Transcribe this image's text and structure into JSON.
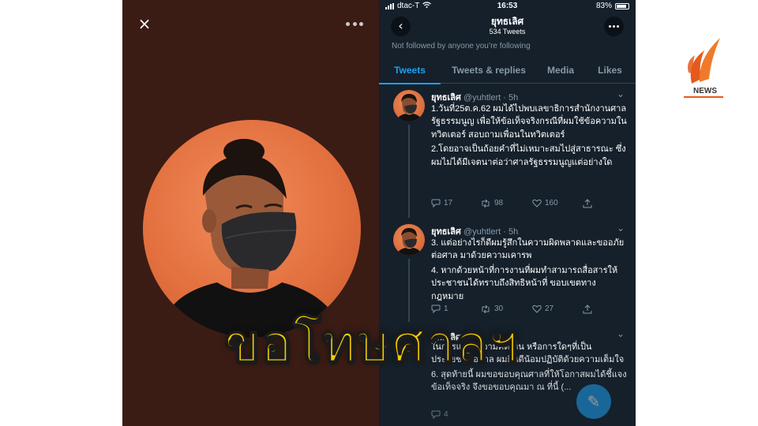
{
  "photo_viewer": {
    "close_icon_glyph": "×",
    "more_icon": "more-horizontal-icon"
  },
  "status_bar": {
    "carrier": "dtac-T",
    "time": "16:53",
    "battery": "83%"
  },
  "profile": {
    "name": "ยุทธเลิศ",
    "tweet_count": "534 Tweets",
    "follow_note": "Not followed by anyone you’re following"
  },
  "tabs": [
    {
      "label": "Tweets",
      "active": true
    },
    {
      "label": "Tweets & replies",
      "active": false
    },
    {
      "label": "Media",
      "active": false
    },
    {
      "label": "Likes",
      "active": false
    }
  ],
  "tweets": [
    {
      "name": "ยุทธเลิศ",
      "handle": "@yuhtlert · 5h",
      "paragraphs": [
        "1.วันที่25ต.ค.62 ผมได้ไปพบเลขาธิการสำนักงานศาลรัฐธรรมนูญ เพื่อให้ข้อเท็จจริงกรณีที่ผมใช้ข้อความในทวิตเตอร์ สอบถามเพื่อนในทวิตเตอร์",
        "2.โดยอาจเป็นถ้อยคำที่ไม่เหมาะสมไปสู่สาธารณะ ซึ่งผมไม่ได้มีเจตนาต่อว่าศาลรัฐธรรมนูญแต่อย่างใด"
      ],
      "replies": "17",
      "retweets": "98",
      "likes": "160"
    },
    {
      "name": "ยุทธเลิศ",
      "handle": "@yuhtlert · 5h",
      "paragraphs": [
        "3. แต่อย่างไรก็ดีผมรู้สึกในความผิดพลาดและขออภัยต่อศาล มาด้วยความเคารพ",
        "4. หากด้วยหน้าที่การงานที่ผมทำสามารถสื่อสารให้ประชาชนได้ทราบถึงสิทธิหน้าที่ ขอบเขตทางกฎหมาย"
      ],
      "replies": "1",
      "retweets": "30",
      "likes": "27"
    },
    {
      "name": "ยุทธเลิศ",
      "handle": "",
      "paragraphs": [
        "ในการแสดงความคิดเห็น หรือการใดๆที่เป็นประโยชน์ต่อศาล ผมยินดีน้อมปฏิบัติด้วยความเต็มใจ",
        "6. สุดท้ายนี้ ผมขอขอบคุณศาลที่ให้โอกาสผมได้ชี้แจงข้อเท็จจริง จึงขอขอบคุณมา ณ ที่นี้ (..."
      ],
      "replies": "4",
      "retweets": "",
      "likes": ""
    }
  ],
  "caption": "ขอโทษศาลฯ",
  "logo": {
    "text": "NEWS",
    "accent": "#e55a1c"
  },
  "colors": {
    "twitter_bg": "#15202b",
    "twitter_blue": "#1da1f2",
    "caption_yellow": "#f4cc00",
    "photo_bg": "#3a1c15"
  }
}
